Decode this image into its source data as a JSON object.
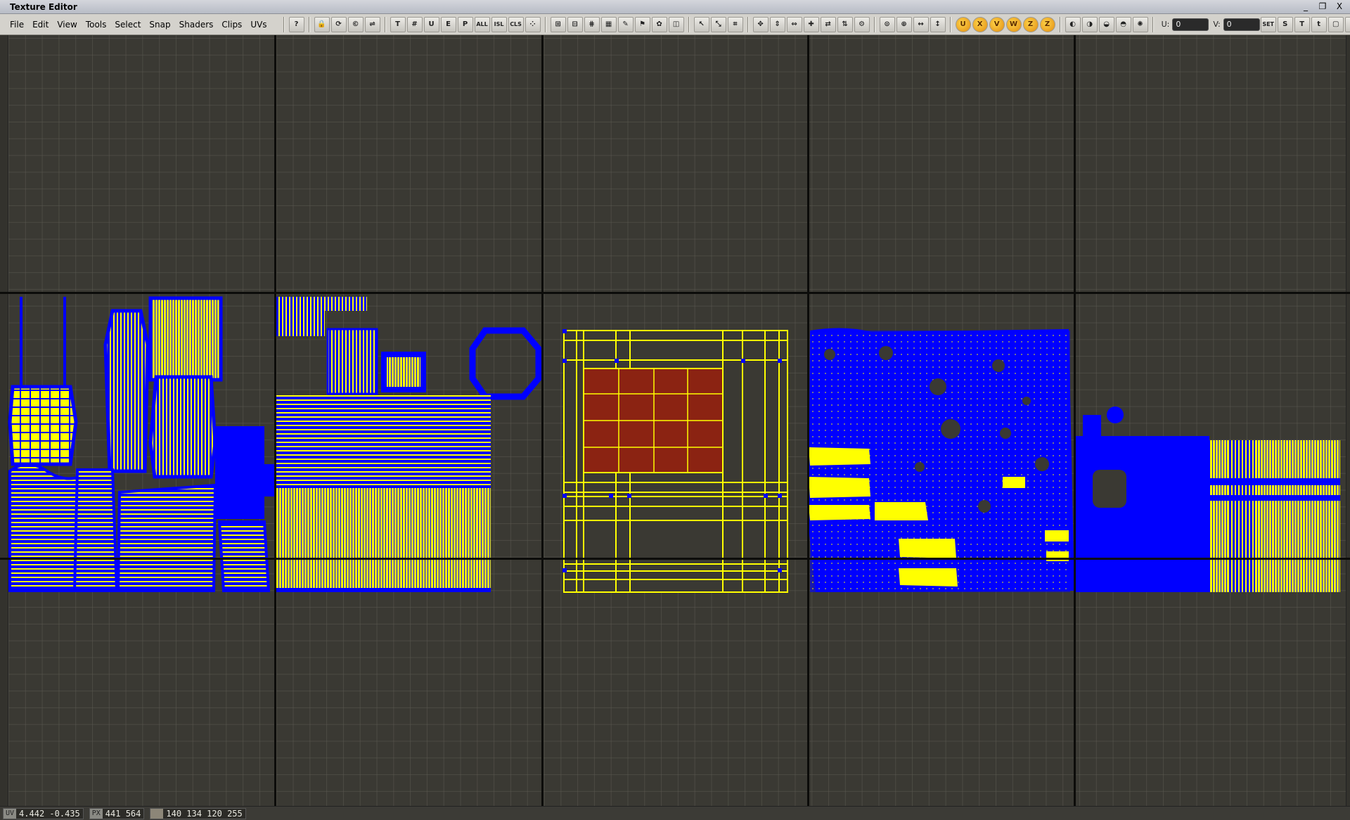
{
  "window": {
    "title": "Texture Editor",
    "buttons": [
      "_",
      "❐",
      "X"
    ]
  },
  "menu": [
    {
      "name": "menu-file",
      "label": "File"
    },
    {
      "name": "menu-edit",
      "label": "Edit"
    },
    {
      "name": "menu-view",
      "label": "View"
    },
    {
      "name": "menu-tools",
      "label": "Tools"
    },
    {
      "name": "menu-select",
      "label": "Select"
    },
    {
      "name": "menu-snap",
      "label": "Snap"
    },
    {
      "name": "menu-shaders",
      "label": "Shaders"
    },
    {
      "name": "menu-clips",
      "label": "Clips"
    },
    {
      "name": "menu-uvs",
      "label": "UVs"
    }
  ],
  "toolbar": {
    "groups": [
      [
        {
          "icon": "help-icon",
          "glyph": "?"
        }
      ],
      [
        {
          "icon": "lock-icon",
          "glyph": "🔒"
        },
        {
          "icon": "sync-icon",
          "glyph": "⟳"
        },
        {
          "icon": "copy-icon",
          "glyph": "©"
        },
        {
          "icon": "link-icon",
          "glyph": "⇌"
        }
      ],
      [
        {
          "icon": "text-tool-icon",
          "glyph": "T"
        },
        {
          "icon": "grid-snap-icon",
          "glyph": "#"
        },
        {
          "icon": "uv-snap-icon",
          "glyph": "U"
        },
        {
          "icon": "edge-snap-icon",
          "glyph": "E"
        },
        {
          "icon": "point-snap-icon",
          "glyph": "P"
        },
        {
          "icon": "select-all-icon",
          "glyph": "ALL",
          "small": true
        },
        {
          "icon": "select-island-icon",
          "glyph": "ISL",
          "small": true
        },
        {
          "icon": "select-cluster-icon",
          "glyph": "CLS",
          "small": true
        },
        {
          "icon": "grid-dots-icon",
          "glyph": "⁘"
        }
      ],
      [
        {
          "icon": "snap-grid-icon",
          "glyph": "⊞"
        },
        {
          "icon": "snap-grid-alt-icon",
          "glyph": "⊟"
        },
        {
          "icon": "snap-cross-icon",
          "glyph": "⋕"
        },
        {
          "icon": "color-checker-icon",
          "glyph": "▦"
        },
        {
          "icon": "pin-icon",
          "glyph": "✎"
        },
        {
          "icon": "flag-icon",
          "glyph": "⚑"
        },
        {
          "icon": "stamp-icon",
          "glyph": "✿"
        },
        {
          "icon": "split-icon",
          "glyph": "◫"
        }
      ],
      [
        {
          "icon": "pointer-icon",
          "glyph": "↖"
        },
        {
          "icon": "transform-pointer-icon",
          "glyph": "⤡"
        },
        {
          "icon": "crop-icon",
          "glyph": "⌗"
        }
      ],
      [
        {
          "icon": "move-all-icon",
          "glyph": "✥"
        },
        {
          "icon": "move-vertical-icon",
          "glyph": "⇕"
        },
        {
          "icon": "move-horizontal-icon",
          "glyph": "⇔"
        },
        {
          "icon": "plus-icon",
          "glyph": "✚"
        },
        {
          "icon": "flip-u-icon",
          "glyph": "⇄"
        },
        {
          "icon": "flip-v-icon",
          "glyph": "⇅"
        },
        {
          "icon": "gear-icon",
          "glyph": "⚙"
        }
      ],
      [
        {
          "icon": "zoom-fit-icon",
          "glyph": "⊙"
        },
        {
          "icon": "zoom-icon",
          "glyph": "⊕"
        },
        {
          "icon": "pan-h-icon",
          "glyph": "↔"
        },
        {
          "icon": "pan-v-icon",
          "glyph": "↕"
        }
      ],
      [
        {
          "icon": "orbit-u-icon",
          "glyph": "U",
          "orange": true
        },
        {
          "icon": "orbit-x-icon",
          "glyph": "X",
          "orange": true
        },
        {
          "icon": "orbit-v-icon",
          "glyph": "V",
          "orange": true
        },
        {
          "icon": "orbit-w-icon",
          "glyph": "W",
          "orange": true
        },
        {
          "icon": "orbit-z-icon",
          "glyph": "Z",
          "orange": true
        },
        {
          "icon": "orbit-z-alt-icon",
          "glyph": "Z",
          "orange": true
        }
      ],
      [
        {
          "icon": "relax-icon",
          "glyph": "◐"
        },
        {
          "icon": "unfold-icon",
          "glyph": "◑"
        },
        {
          "icon": "stitch-icon",
          "glyph": "◒"
        },
        {
          "icon": "align-icon",
          "glyph": "◓"
        },
        {
          "icon": "paint-icon",
          "glyph": "✺"
        }
      ]
    ],
    "u_label": "U:",
    "u_value": "0",
    "v_label": "V:",
    "v_value": "0",
    "tail": [
      {
        "icon": "set-icon",
        "glyph": "SET",
        "small": true
      },
      {
        "icon": "scale-icon",
        "glyph": "S"
      },
      {
        "icon": "tile-icon",
        "glyph": "T"
      },
      {
        "icon": "tile-alt-icon",
        "glyph": "t"
      },
      {
        "icon": "frame-icon",
        "glyph": "▢"
      },
      {
        "icon": "snap-point-icon",
        "glyph": "⌖"
      },
      {
        "icon": "extra-tool-icon",
        "glyph": "⚒"
      }
    ]
  },
  "viewport": {
    "background": "#3a3933",
    "uv_wire_color": "#ffff00",
    "uv_edge_color": "#0000ff",
    "selection_color": "#8b2312"
  },
  "status": {
    "uv_label": "UV",
    "uv_value": "4.442  -0.435",
    "px_label": "PX",
    "px_value": "441   564",
    "rgba_value": "140 134 120 255"
  }
}
